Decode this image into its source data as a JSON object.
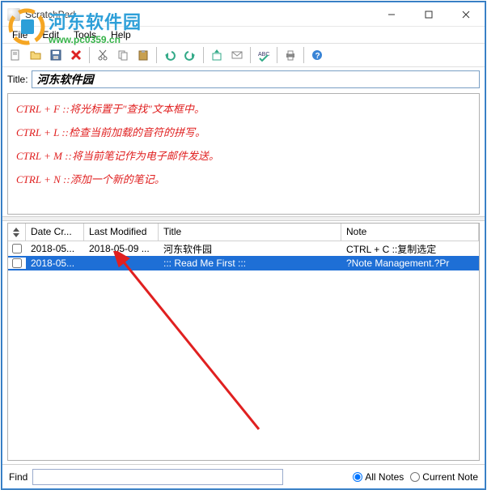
{
  "window": {
    "title": "ScratchPad"
  },
  "watermark": {
    "text_cn": "河东软件园",
    "url": "www.pc0359.cn"
  },
  "menu": {
    "file": "File",
    "edit": "Edit",
    "tools": "Tools",
    "help": "Help"
  },
  "toolbar": {
    "icons": [
      "new",
      "open",
      "save",
      "delete",
      "cut",
      "copy",
      "paste",
      "undo",
      "redo",
      "import",
      "email",
      "spell",
      "print",
      "help"
    ]
  },
  "title_row": {
    "label": "Title:",
    "value": "河东软件园"
  },
  "editor": {
    "lines": [
      "CTRL + F ::将光标置于\"查找\"文本框中。",
      "CTRL + L ::检查当前加载的音符的拼写。",
      "CTRL + M ::将当前笔记作为电子邮件发送。",
      "CTRL + N ::添加一个新的笔记。"
    ]
  },
  "list": {
    "headers": {
      "created": "Date Cr...",
      "modified": "Last Modified",
      "title": "Title",
      "note": "Note"
    },
    "rows": [
      {
        "checked": false,
        "created": "2018-05...",
        "modified": "2018-05-09 ...",
        "title": "河东软件园",
        "note": "CTRL + C ::复制选定",
        "selected": false
      },
      {
        "checked": false,
        "created": "2018-05...",
        "modified": "",
        "title": "::: Read Me First :::",
        "note": "?Note Management.?Pr",
        "selected": true
      }
    ]
  },
  "find": {
    "label": "Find",
    "value": "",
    "all_notes": "All Notes",
    "current_note": "Current Note",
    "selected": "all"
  }
}
